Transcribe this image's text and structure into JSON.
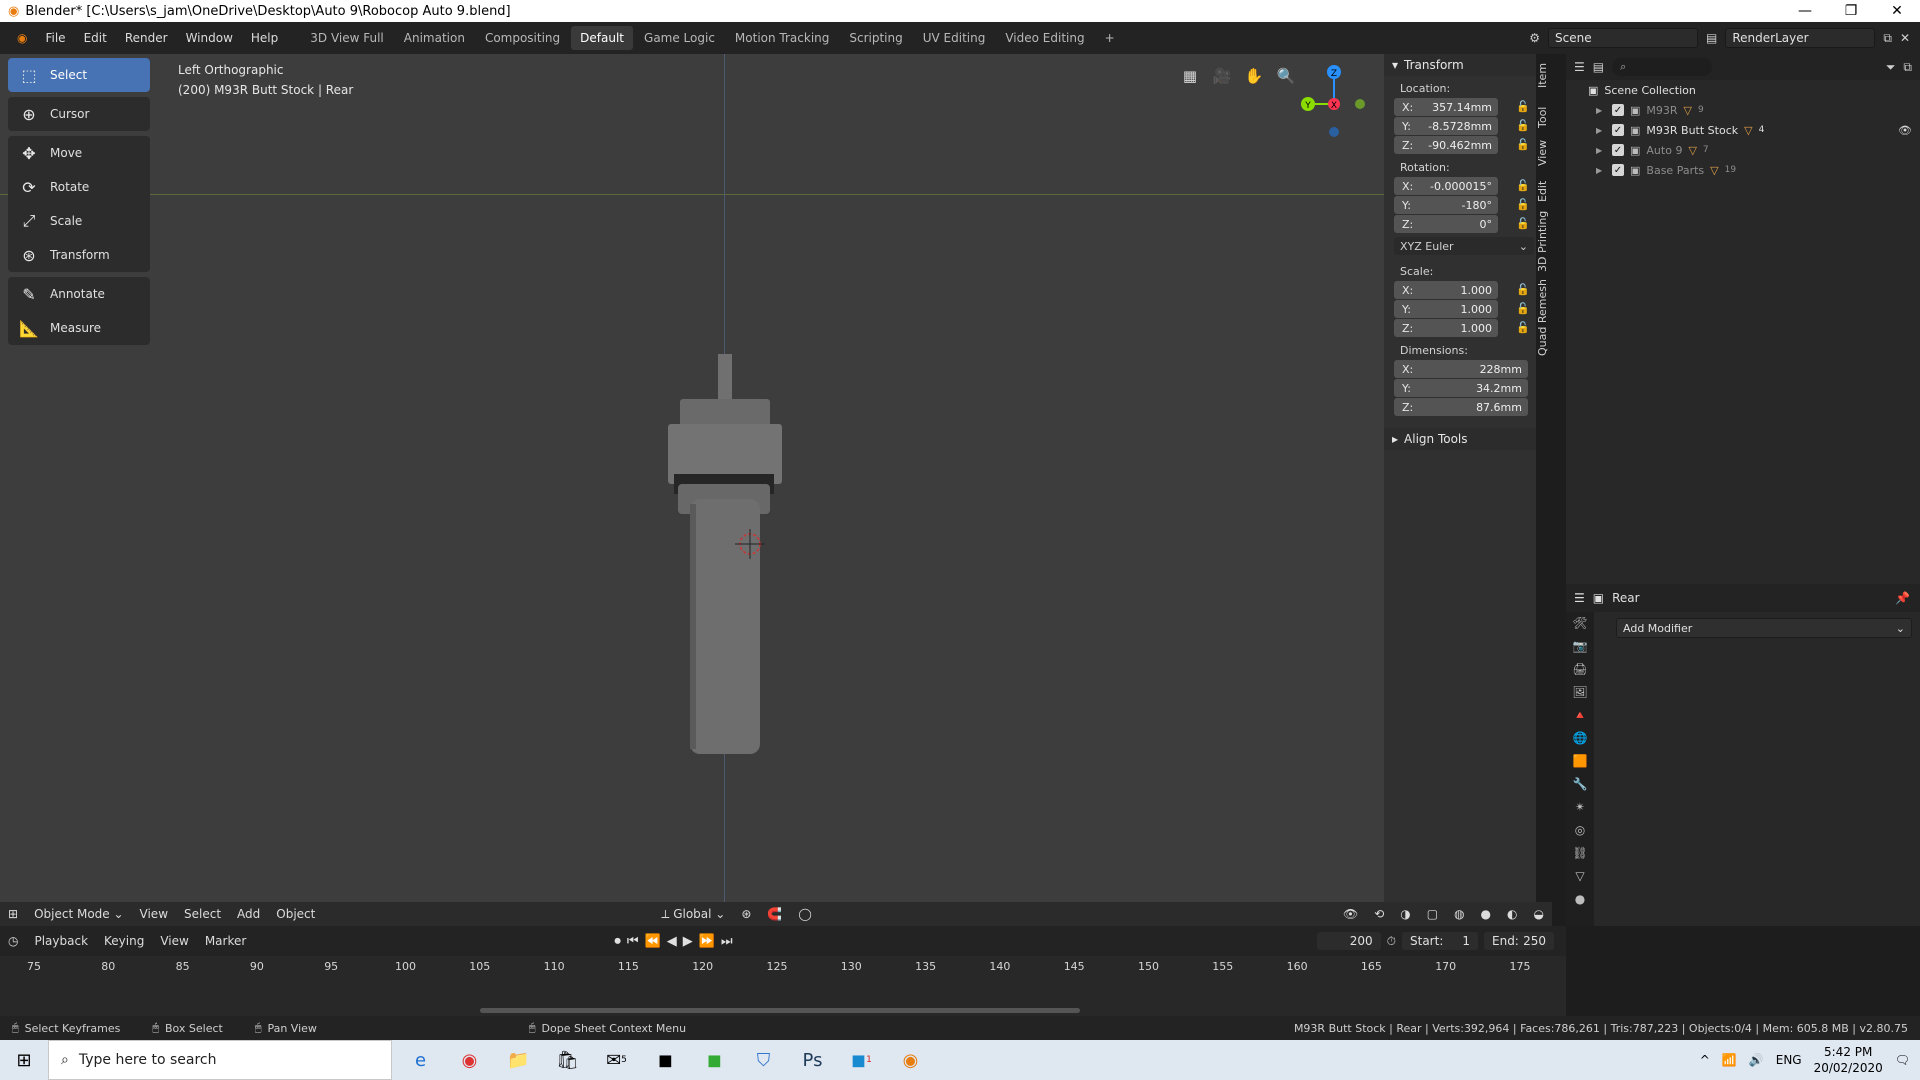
{
  "window": {
    "title": "Blender* [C:\\Users\\s_jam\\OneDrive\\Desktop\\Auto 9\\Robocop Auto 9.blend]"
  },
  "menu": [
    "File",
    "Edit",
    "Render",
    "Window",
    "Help"
  ],
  "workspaces": {
    "tabs": [
      "3D View Full",
      "Animation",
      "Compositing",
      "Default",
      "Game Logic",
      "Motion Tracking",
      "Scripting",
      "UV Editing",
      "Video Editing"
    ],
    "active": "Default"
  },
  "topright": {
    "scene": "Scene",
    "render_layer": "RenderLayer"
  },
  "viewport": {
    "view_name": "Left Orthographic",
    "object_info": "(200) M93R Butt Stock | Rear"
  },
  "tools": [
    {
      "label": "Select",
      "icon": "select-box-icon",
      "active": true
    },
    {
      "label": "Cursor",
      "icon": "cursor-icon"
    },
    {
      "label": "Move",
      "icon": "move-icon"
    },
    {
      "label": "Rotate",
      "icon": "rotate-icon"
    },
    {
      "label": "Scale",
      "icon": "scale-icon"
    },
    {
      "label": "Transform",
      "icon": "transform-icon"
    },
    {
      "label": "Annotate",
      "icon": "annotate-icon"
    },
    {
      "label": "Measure",
      "icon": "measure-icon"
    }
  ],
  "gizmo": {
    "z": "Z",
    "y": "Y",
    "x": "X"
  },
  "sidebar_tabs": [
    "Item",
    "Tool",
    "View",
    "Edit",
    "3D Printing",
    "Quad Remesh"
  ],
  "transform": {
    "header": "Transform",
    "location_label": "Location:",
    "location": [
      {
        "k": "X:",
        "v": "357.14mm"
      },
      {
        "k": "Y:",
        "v": "-8.5728mm"
      },
      {
        "k": "Z:",
        "v": "-90.462mm"
      }
    ],
    "rotation_label": "Rotation:",
    "rotation": [
      {
        "k": "X:",
        "v": "-0.000015°"
      },
      {
        "k": "Y:",
        "v": "-180°"
      },
      {
        "k": "Z:",
        "v": "0°"
      }
    ],
    "rotation_mode": "XYZ Euler",
    "scale_label": "Scale:",
    "scale": [
      {
        "k": "X:",
        "v": "1.000"
      },
      {
        "k": "Y:",
        "v": "1.000"
      },
      {
        "k": "Z:",
        "v": "1.000"
      }
    ],
    "dimensions_label": "Dimensions:",
    "dimensions": [
      {
        "k": "X:",
        "v": "228mm"
      },
      {
        "k": "Y:",
        "v": "34.2mm"
      },
      {
        "k": "Z:",
        "v": "87.6mm"
      }
    ],
    "align_tools": "Align Tools"
  },
  "outliner": {
    "root": "Scene Collection",
    "rows": [
      {
        "name": "M93R",
        "count": "9",
        "dim": true
      },
      {
        "name": "M93R Butt Stock",
        "count": "4",
        "dim": false
      },
      {
        "name": "Auto 9",
        "count": "7",
        "dim": true
      },
      {
        "name": "Base Parts",
        "count": "19",
        "dim": true
      }
    ]
  },
  "properties": {
    "object": "Rear",
    "add_modifier": "Add Modifier"
  },
  "viewport_header": {
    "mode": "Object Mode",
    "menus": [
      "View",
      "Select",
      "Add",
      "Object"
    ],
    "orientation": "Global"
  },
  "timeline": {
    "menus": [
      "Playback",
      "Keying",
      "View",
      "Marker"
    ],
    "current_frame": "200",
    "start_label": "Start:",
    "start": "1",
    "end_label": "End:",
    "end": "250",
    "ruler": [
      "75",
      "80",
      "85",
      "90",
      "95",
      "100",
      "105",
      "110",
      "115",
      "120",
      "125",
      "130",
      "135",
      "140",
      "145",
      "150",
      "155",
      "160",
      "165",
      "170",
      "175"
    ]
  },
  "statusbar": {
    "hints": [
      "Select Keyframes",
      "Box Select",
      "Pan View",
      "Dope Sheet Context Menu"
    ],
    "stats": "M93R Butt Stock | Rear | Verts:392,964 | Faces:786,261 | Tris:787,223 | Objects:0/4 | Mem: 605.8 MB | v2.80.75"
  },
  "taskbar": {
    "search_placeholder": "Type here to search",
    "lang": "ENG",
    "time": "5:42 PM",
    "date": "20/02/2020",
    "mail_badge": "5",
    "app_badge": "1"
  },
  "colors": {
    "accent": "#4772b3",
    "axis_x": "#ff3352",
    "axis_y": "#8bdc00",
    "axis_z": "#2890ff"
  }
}
